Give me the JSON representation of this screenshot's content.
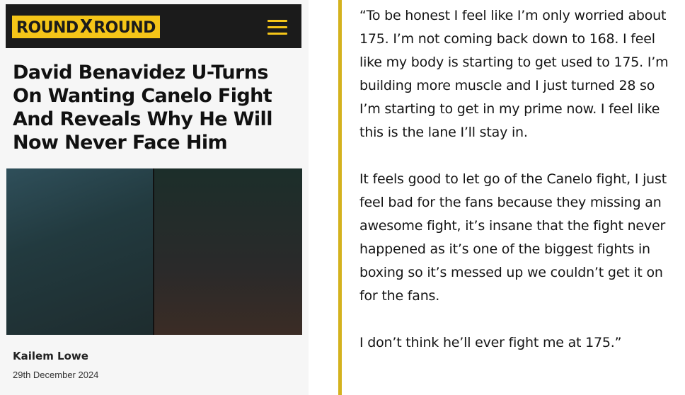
{
  "header": {
    "logo": {
      "part1": "ROUND",
      "x": "X",
      "part2": "ROUND"
    },
    "menu_icon": "hamburger-icon",
    "colors": {
      "bar": "#1b1b1b",
      "accent": "#f5c518"
    }
  },
  "article": {
    "title": "David Benavidez U-Turns On Wanting Canelo Fight And Reveals Why He Will Now Never Face Him",
    "author": "Kailem Lowe",
    "date": "29th December 2024"
  },
  "quote": {
    "paragraph1": "“To be honest I feel like I’m only worried about 175. I’m not coming back down to 168. I feel like my body is starting to get used to 175. I’m building more muscle and I just turned 28 so I’m starting to get in my prime now. I feel like this is the lane I’ll stay in.",
    "paragraph2": "It feels good to let go of the Canelo fight, I just feel bad for the fans because they missing an awesome fight, it’s insane that the fight never happened as it’s one of the biggest fights in boxing so it’s messed up we couldn’t get it on for the fans.",
    "paragraph3": "I don’t think he’ll ever fight me at 175.”",
    "accent_color": "#d4b21e"
  }
}
